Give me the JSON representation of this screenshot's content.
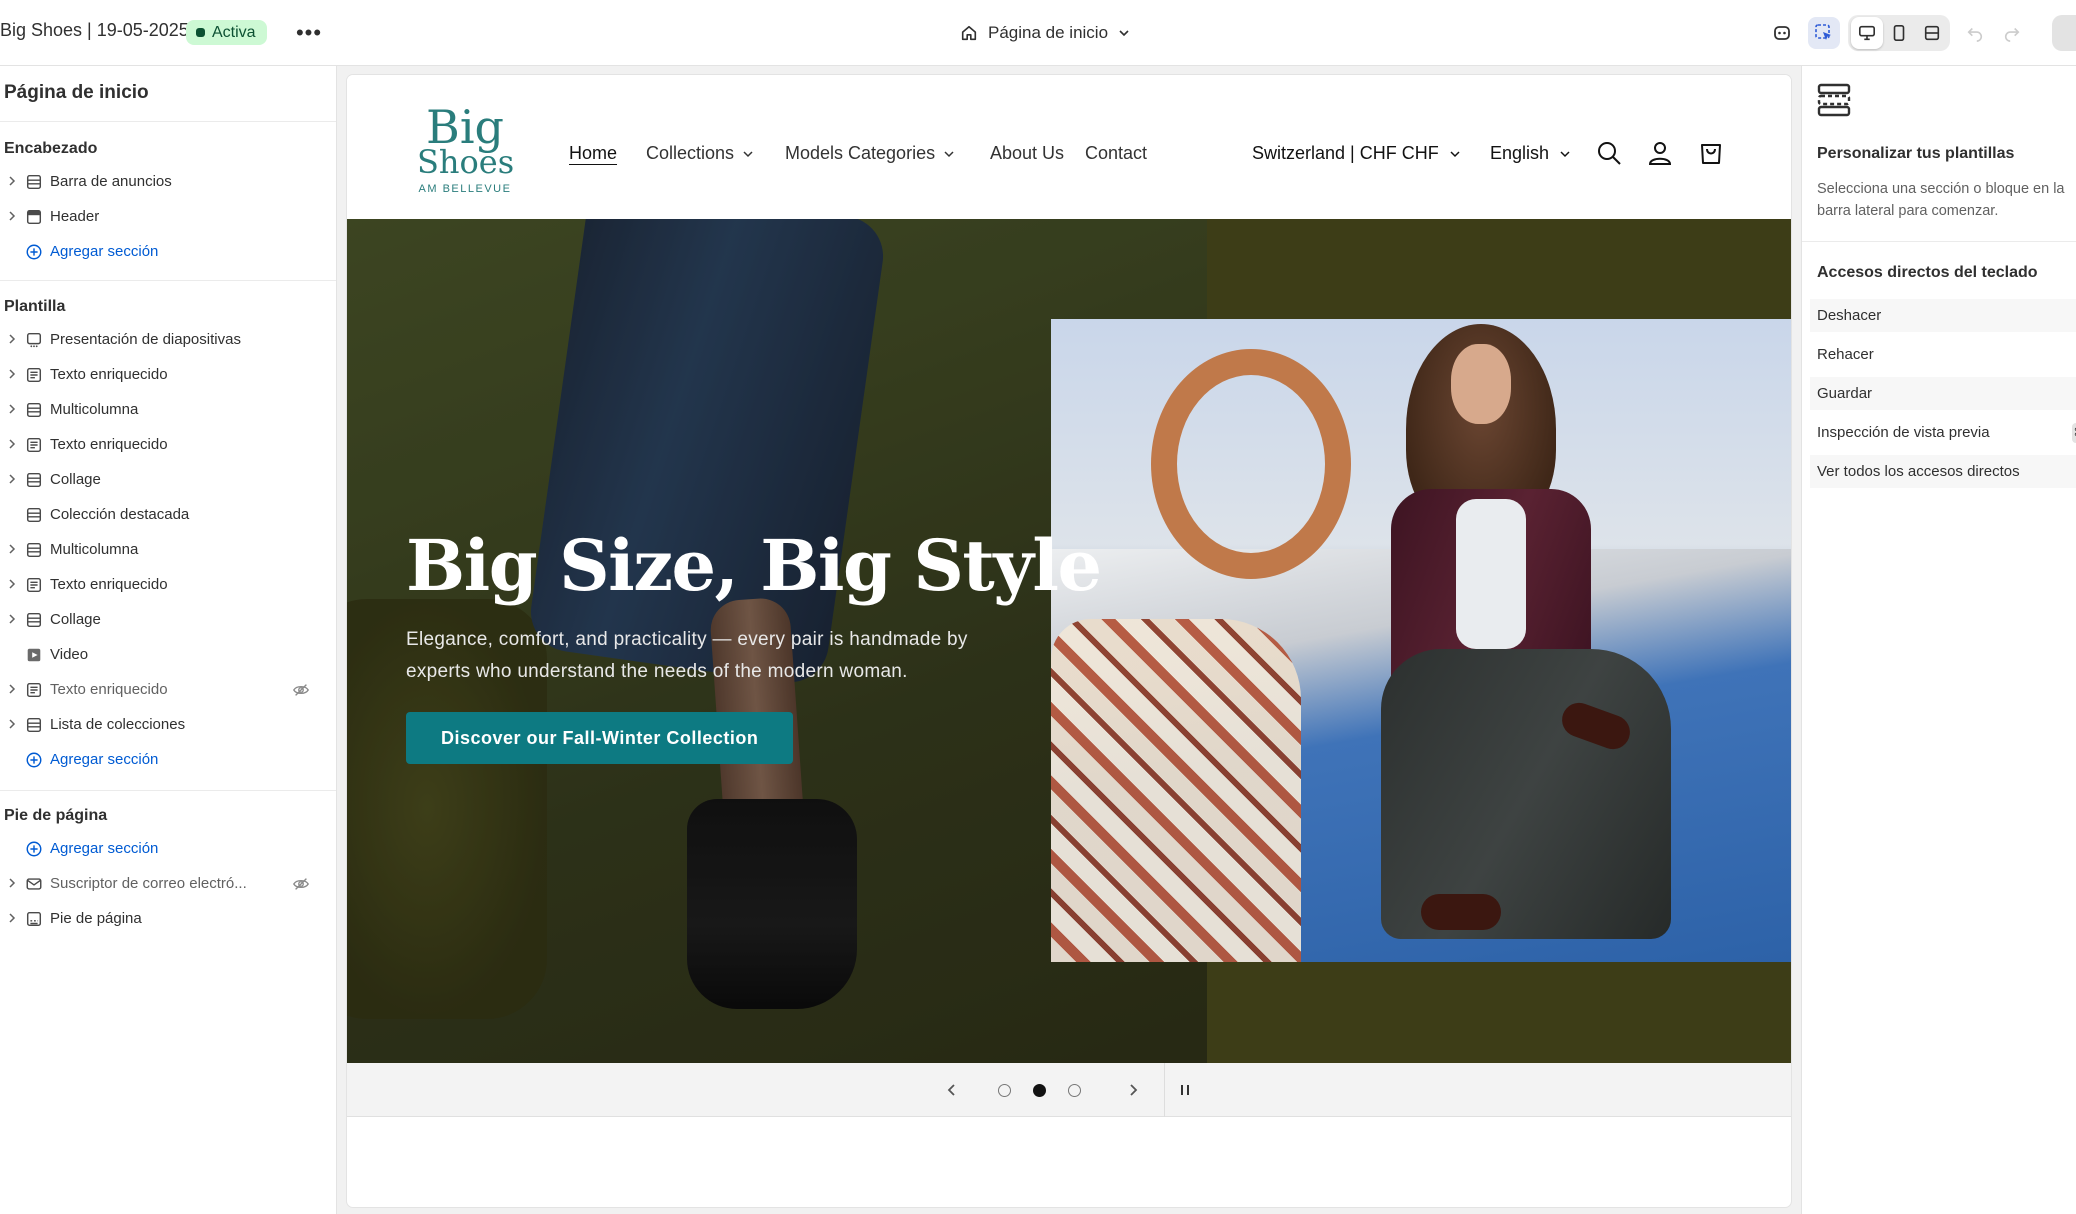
{
  "topbar": {
    "store_title": "Big Shoes | 19-05-2025",
    "status": "Activa",
    "more": "•••",
    "page_select": "Página de inicio"
  },
  "sidebar": {
    "title": "Página de inicio",
    "groups": {
      "header": {
        "label": "Encabezado",
        "items": [
          {
            "label": "Barra de anuncios",
            "icon": "section-icon"
          },
          {
            "label": "Header",
            "icon": "header-section-icon"
          }
        ],
        "add": "Agregar sección"
      },
      "template": {
        "label": "Plantilla",
        "items": [
          {
            "label": "Presentación de diapositivas",
            "icon": "slideshow-icon"
          },
          {
            "label": "Texto enriquecido",
            "icon": "text-section-icon"
          },
          {
            "label": "Multicolumna",
            "icon": "section-icon"
          },
          {
            "label": "Texto enriquecido",
            "icon": "text-section-icon"
          },
          {
            "label": "Collage",
            "icon": "section-icon"
          },
          {
            "label": "Colección destacada",
            "icon": "section-icon"
          },
          {
            "label": "Multicolumna",
            "icon": "section-icon"
          },
          {
            "label": "Texto enriquecido",
            "icon": "text-section-icon"
          },
          {
            "label": "Collage",
            "icon": "section-icon"
          },
          {
            "label": "Video",
            "icon": "video-icon"
          },
          {
            "label": "Texto enriquecido",
            "icon": "text-section-icon",
            "hidden": true
          },
          {
            "label": "Lista de colecciones",
            "icon": "section-icon"
          }
        ],
        "add": "Agregar sección"
      },
      "footer": {
        "label": "Pie de página",
        "add": "Agregar sección",
        "items": [
          {
            "label": "Suscriptor de correo electró...",
            "icon": "email-icon",
            "hidden": true
          },
          {
            "label": "Pie de página",
            "icon": "footer-section-icon"
          }
        ]
      }
    }
  },
  "right_panel": {
    "title": "Personalizar tus plantillas",
    "description": "Selecciona una sección o bloque en la barra lateral para comenzar.",
    "shortcuts_title": "Accesos directos del teclado",
    "shortcuts": [
      "Deshacer",
      "Rehacer",
      "Guardar",
      "Inspección de vista previa",
      "Ver todos los accesos directos"
    ],
    "kbd": "⌘"
  },
  "preview": {
    "logo": {
      "line1": "Big",
      "line2": "Shoes",
      "line3": "AM BELLEVUE"
    },
    "nav": [
      {
        "label": "Home",
        "dropdown": false
      },
      {
        "label": "Collections",
        "dropdown": true
      },
      {
        "label": "Models Categories",
        "dropdown": true
      },
      {
        "label": "About Us",
        "dropdown": false
      },
      {
        "label": "Contact",
        "dropdown": false
      }
    ],
    "country": "Switzerland | CHF CHF",
    "language": "English",
    "hero": {
      "title": "Big Size, Big Style",
      "subtitle": "Elegance, comfort, and practicality — every pair is handmade by experts who understand the needs of the modern woman.",
      "cta": "Discover our Fall-Winter Collection"
    },
    "slides": {
      "count": 3,
      "active": 2
    }
  },
  "colors": {
    "accent_blue": "#005bd3",
    "teal_brand": "#2a7d7c",
    "cta": "#0d7a82",
    "status_bg": "#cdf9d4",
    "status_fg": "#0c5132"
  }
}
